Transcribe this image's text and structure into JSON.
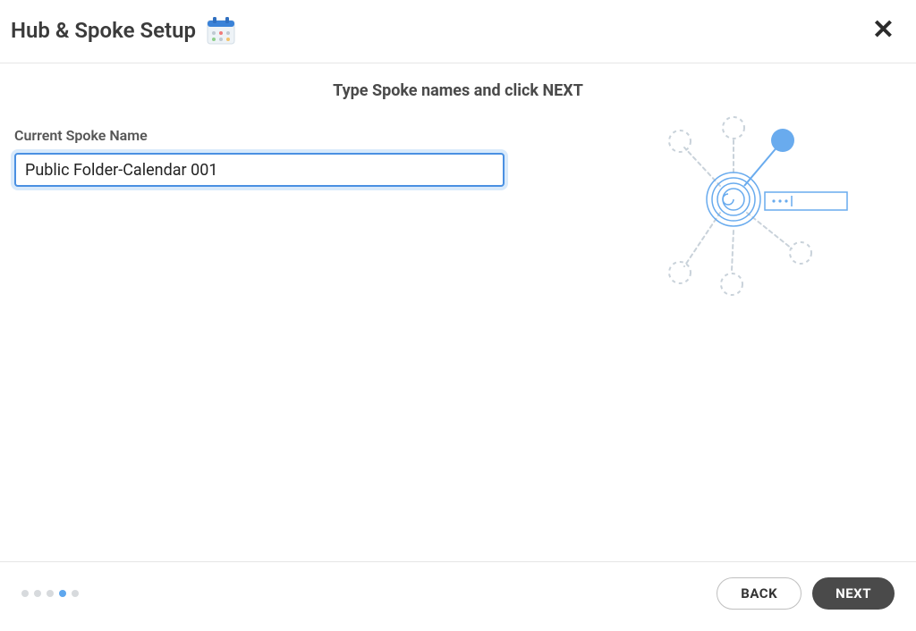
{
  "header": {
    "title": "Hub & Spoke Setup"
  },
  "instruction": "Type Spoke names and click NEXT",
  "field": {
    "label": "Current Spoke Name",
    "value": "Public Folder-Calendar 001"
  },
  "footer": {
    "back_label": "BACK",
    "next_label": "NEXT",
    "progress": {
      "total": 5,
      "active_index": 3
    }
  }
}
